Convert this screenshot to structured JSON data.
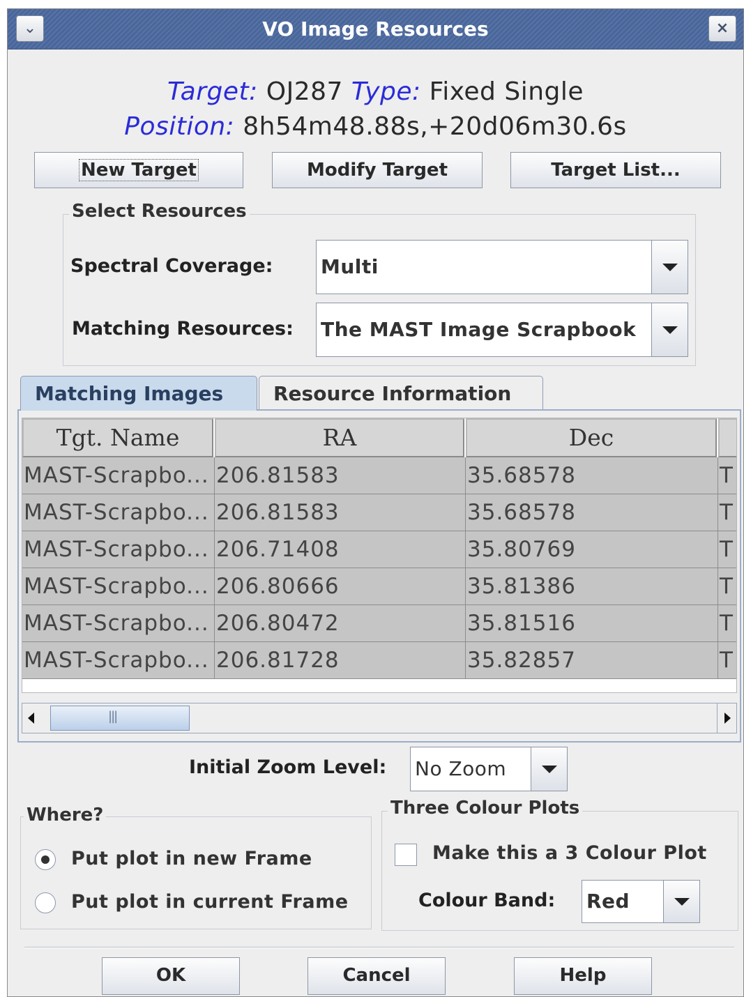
{
  "window": {
    "title": "VO Image Resources",
    "menu_icon": "chevron-down-icon",
    "close_icon": "close-icon"
  },
  "target": {
    "target_label": "Target:",
    "target_value": "OJ287",
    "type_label": "Type:",
    "type_value": "Fixed Single",
    "position_label": "Position:",
    "position_value": "8h54m48.88s,+20d06m30.6s"
  },
  "buttons": {
    "new_target": "New Target",
    "modify_target": "Modify Target",
    "target_list": "Target List...",
    "ok": "OK",
    "cancel": "Cancel",
    "help": "Help"
  },
  "select_resources": {
    "title": "Select Resources",
    "spectral_label": "Spectral Coverage:",
    "spectral_value": "Multi",
    "matching_label": "Matching Resources:",
    "matching_value": "The MAST Image Scrapbook"
  },
  "tabs": [
    {
      "label": "Matching Images",
      "active": true
    },
    {
      "label": "Resource Information",
      "active": false
    }
  ],
  "table": {
    "columns": [
      "Tgt. Name",
      "RA",
      "Dec"
    ],
    "rows": [
      [
        "MAST-Scrapbo...",
        "206.81583",
        "35.68578",
        "T"
      ],
      [
        "MAST-Scrapbo...",
        "206.81583",
        "35.68578",
        "T"
      ],
      [
        "MAST-Scrapbo...",
        "206.71408",
        "35.80769",
        "T"
      ],
      [
        "MAST-Scrapbo...",
        "206.80666",
        "35.81386",
        "T"
      ],
      [
        "MAST-Scrapbo...",
        "206.80472",
        "35.81516",
        "T"
      ],
      [
        "MAST-Scrapbo...",
        "206.81728",
        "35.82857",
        "T"
      ]
    ]
  },
  "zoom": {
    "label": "Initial Zoom Level:",
    "value": "No Zoom"
  },
  "where": {
    "title": "Where?",
    "options": [
      {
        "label": "Put plot in new Frame",
        "selected": true
      },
      {
        "label": "Put plot in current Frame",
        "selected": false
      }
    ]
  },
  "three_colour": {
    "title": "Three Colour Plots",
    "checkbox_label": "Make this a 3 Colour Plot",
    "checked": false,
    "band_label": "Colour Band:",
    "band_value": "Red"
  },
  "colors": {
    "title_bar": "#4f6b9f",
    "label_blue": "#2b2bd9",
    "tab_active": "#c9daed",
    "row_bg": "#c5c5c5"
  }
}
